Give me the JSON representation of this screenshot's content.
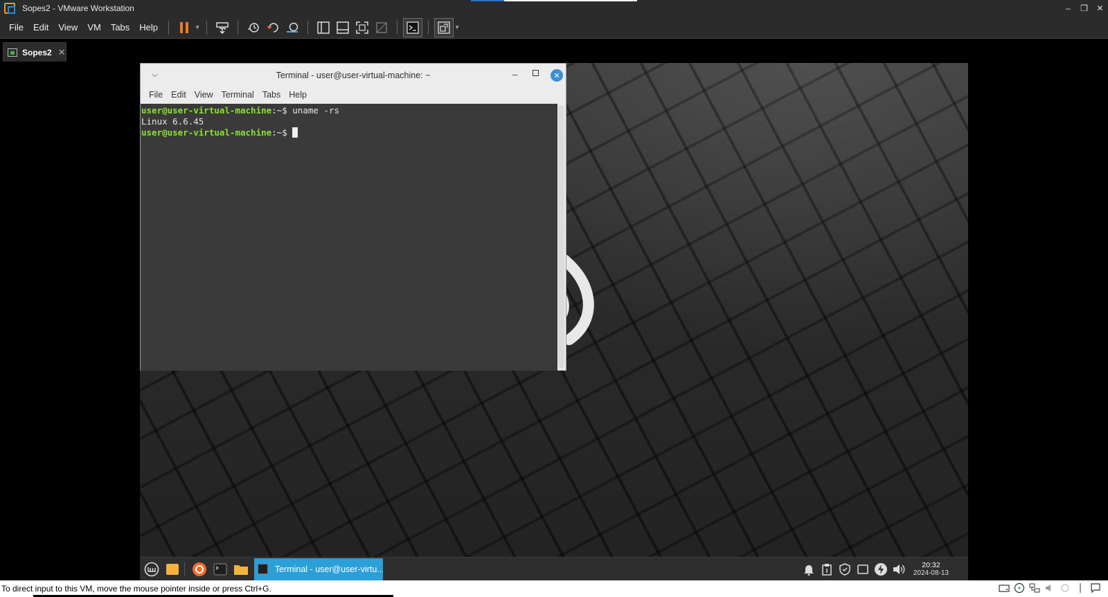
{
  "window": {
    "title": "Sopes2 - VMware Workstation",
    "minimize": "–",
    "restore": "❐",
    "close": "✕"
  },
  "menu": [
    "File",
    "Edit",
    "View",
    "VM",
    "Tabs",
    "Help"
  ],
  "toolbar": {
    "icons": [
      "pause-icon",
      "send-ctrl-alt-del-icon",
      "snapshot-icon",
      "revert-snapshot-icon",
      "snapshot-manager-icon",
      "show-library-icon",
      "thumbnail-bar-icon",
      "full-screen-icon",
      "unity-icon",
      "console-view-icon",
      "stretch-guest-icon"
    ]
  },
  "tab": {
    "label": "Sopes2",
    "close": "✕"
  },
  "terminal": {
    "title": "Terminal - user@user-virtual-machine: ~",
    "menu": [
      "File",
      "Edit",
      "View",
      "Terminal",
      "Tabs",
      "Help"
    ],
    "lines": [
      {
        "prompt_user": "user@user-virtual-machine",
        "prompt_path": ":~$ ",
        "command": "uname -rs"
      },
      {
        "output": "Linux 6.6.45"
      },
      {
        "prompt_user": "user@user-virtual-machine",
        "prompt_path": ":~$ ",
        "command": ""
      }
    ],
    "close_glyph": "✕",
    "minimize_glyph": "–",
    "menu_glyph": "⌵"
  },
  "guest_panel": {
    "task_label": "Terminal - user@user-virtu...",
    "clock_time": "20:32",
    "clock_date": "2024-08-13",
    "accent": "#2a9fd8"
  },
  "statusbar": {
    "hint": "To direct input to this VM, move the mouse pointer inside or press Ctrl+G."
  },
  "colors": {
    "vmware_chrome": "#2b2b2b",
    "prompt_green": "#8ae234",
    "pause_orange": "#f07a1d",
    "terminal_bg": "#3a3a3a"
  }
}
